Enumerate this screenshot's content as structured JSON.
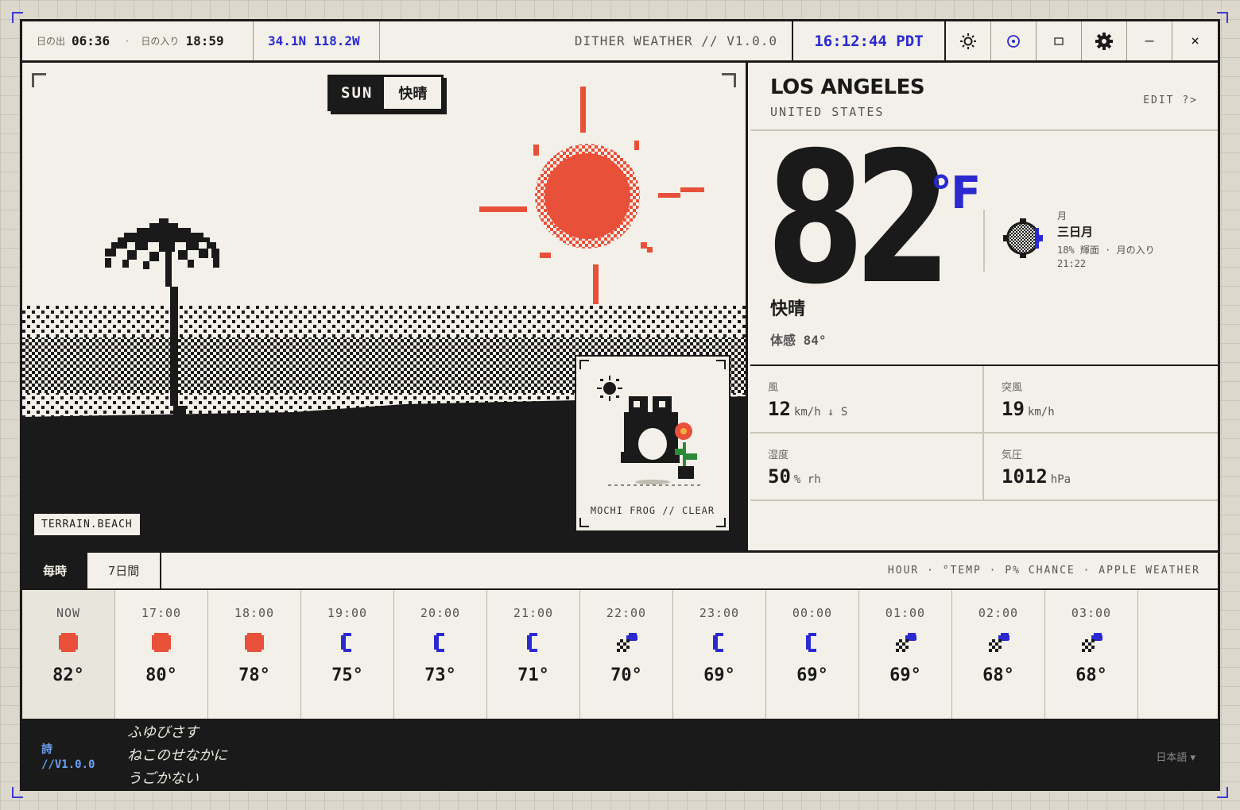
{
  "topbar": {
    "sunrise_label": "日の出",
    "sunrise_time": "06:36",
    "sunset_label": "日の入り",
    "sunset_time": "18:59",
    "separator": "·",
    "coords": "34.1N 118.2W",
    "app_title": "DITHER WEATHER // V1.0.0",
    "clock": "16:12:44 PDT",
    "buttons": [
      "sun-icon",
      "target-icon",
      "window-icon",
      "gear-icon",
      "minimize-icon",
      "close-icon"
    ],
    "minimize_glyph": "–",
    "close_glyph": "×"
  },
  "scene": {
    "day": "SUN",
    "condition": "快晴",
    "terrain_tag": "TERRAIN.BEACH",
    "mascot_caption": "MOCHI FROG // CLEAR"
  },
  "current": {
    "city": "LOS ANGELES",
    "country": "UNITED STATES",
    "edit_label": "EDIT ?>",
    "temp": "82",
    "unit": "°F",
    "condition": "快晴",
    "feels_label": "体感",
    "feels_value": "84°"
  },
  "moon": {
    "label": "月",
    "phase": "三日月",
    "illumination": "18%",
    "illumination_label": "輝面",
    "moonset_label": "月の入り",
    "moonset_time": "21:22"
  },
  "stats": [
    {
      "label": "風",
      "value": "12",
      "unit": "km/h ↓ S"
    },
    {
      "label": "突風",
      "value": "19",
      "unit": "km/h"
    },
    {
      "label": "湿度",
      "value": "50",
      "unit": "% rh"
    },
    {
      "label": "気圧",
      "value": "1012",
      "unit": "hPa"
    }
  ],
  "tabs": {
    "hourly": "毎時",
    "weekly": "7日間",
    "legend": "HOUR · °TEMP · P% CHANCE · APPLE WEATHER"
  },
  "hourly": [
    {
      "time": "NOW",
      "icon": "sun-icon",
      "temp": "82°"
    },
    {
      "time": "17:00",
      "icon": "sun-icon",
      "temp": "80°"
    },
    {
      "time": "18:00",
      "icon": "sun-icon",
      "temp": "78°"
    },
    {
      "time": "19:00",
      "icon": "moon-icon",
      "temp": "75°"
    },
    {
      "time": "20:00",
      "icon": "moon-icon",
      "temp": "73°"
    },
    {
      "time": "21:00",
      "icon": "moon-icon",
      "temp": "71°"
    },
    {
      "time": "22:00",
      "icon": "partly-cloudy-night-icon",
      "temp": "70°"
    },
    {
      "time": "23:00",
      "icon": "moon-icon",
      "temp": "69°"
    },
    {
      "time": "00:00",
      "icon": "moon-icon",
      "temp": "69°"
    },
    {
      "time": "01:00",
      "icon": "partly-cloudy-night-icon",
      "temp": "69°"
    },
    {
      "time": "02:00",
      "icon": "partly-cloudy-night-icon",
      "temp": "68°"
    },
    {
      "time": "03:00",
      "icon": "partly-cloudy-night-icon",
      "temp": "68°"
    }
  ],
  "footer": {
    "poem_label": "詩",
    "version": "//V1.0.0",
    "poem_lines": [
      "ふゆびさす",
      "ねこのせなかに",
      "うごかない"
    ],
    "language": "日本語 ▾"
  },
  "colors": {
    "accent_blue": "#2a2ad0",
    "sun_red": "#e8503a",
    "ink": "#1a1a1a",
    "paper": "#f2f0e8"
  }
}
